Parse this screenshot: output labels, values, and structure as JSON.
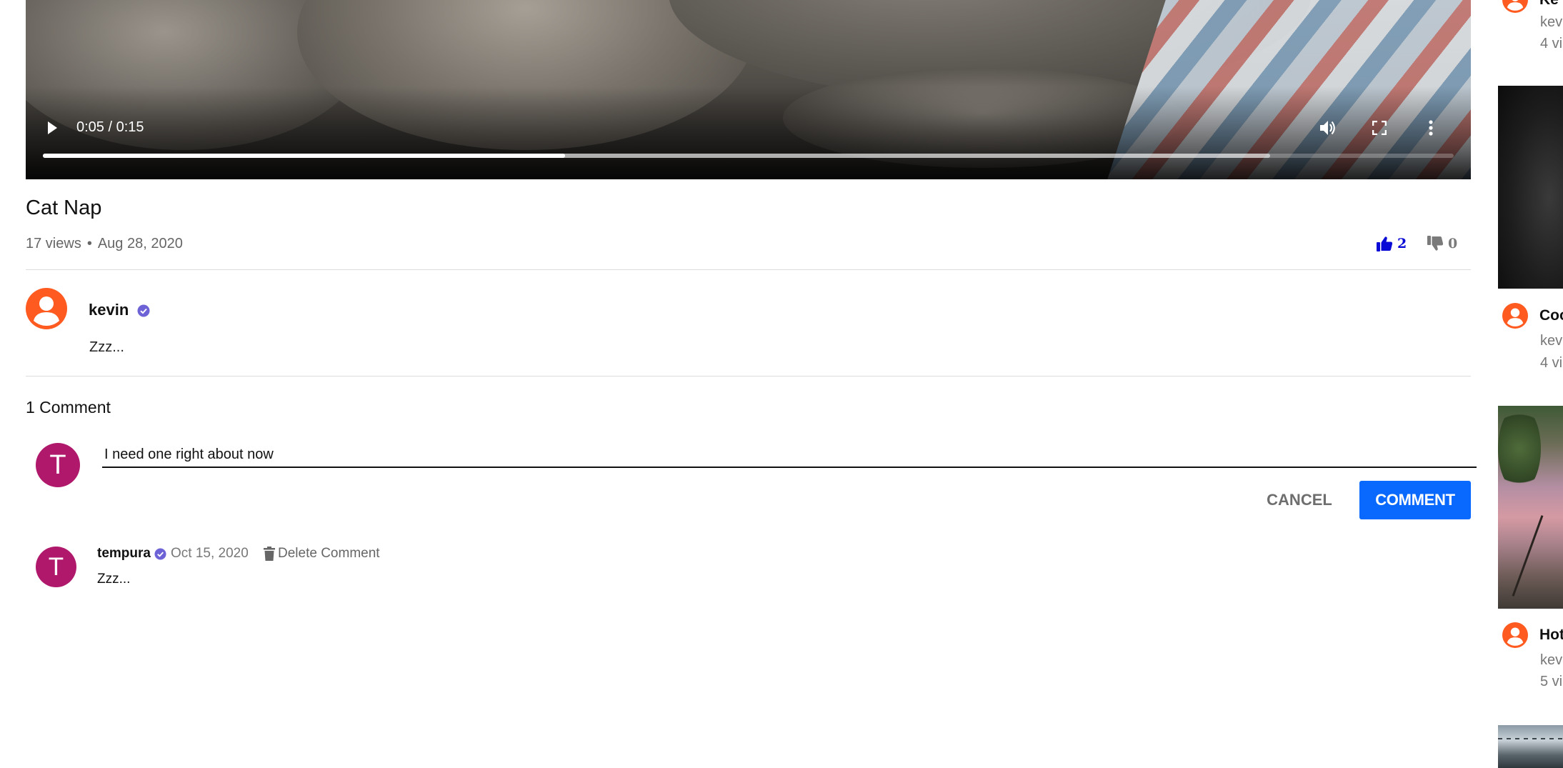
{
  "player": {
    "time_display": "0:05 / 0:15",
    "played_fraction": 0.37,
    "buffered_fraction": 0.87,
    "icons": [
      "play-icon",
      "volume-icon",
      "fullscreen-icon",
      "more-vert-icon"
    ]
  },
  "video": {
    "title": "Cat Nap",
    "views": "17 views",
    "separator": "•",
    "date": "Aug 28, 2020",
    "likes": "2",
    "dislikes": "0"
  },
  "channel": {
    "name": "kevin",
    "verified": true,
    "description": "Zzz..."
  },
  "comments": {
    "count_label": "1 Comment",
    "input": {
      "avatar_letter": "T",
      "value": "I need one right about now"
    },
    "cancel_label": "CANCEL",
    "submit_label": "COMMENT",
    "items": [
      {
        "avatar_letter": "T",
        "author": "tempura",
        "verified": true,
        "date": "Oct 15, 2020",
        "delete_label": "Delete Comment",
        "text": "Zzz..."
      }
    ]
  },
  "sidebar": {
    "items": [
      {
        "title": "Ke",
        "channel": "kev",
        "views": "4 vi"
      },
      {
        "title": "Coo",
        "channel": "kev",
        "views": "4 vi"
      },
      {
        "title": "Hot",
        "channel": "kev",
        "views": "5 vi"
      }
    ]
  },
  "colors": {
    "accent_blue": "#0969ff",
    "like_active": "#0a0ad6",
    "verified": "#6d63d6",
    "channel_avatar": "#ff5a1f",
    "user_avatar": "#b0186b"
  }
}
